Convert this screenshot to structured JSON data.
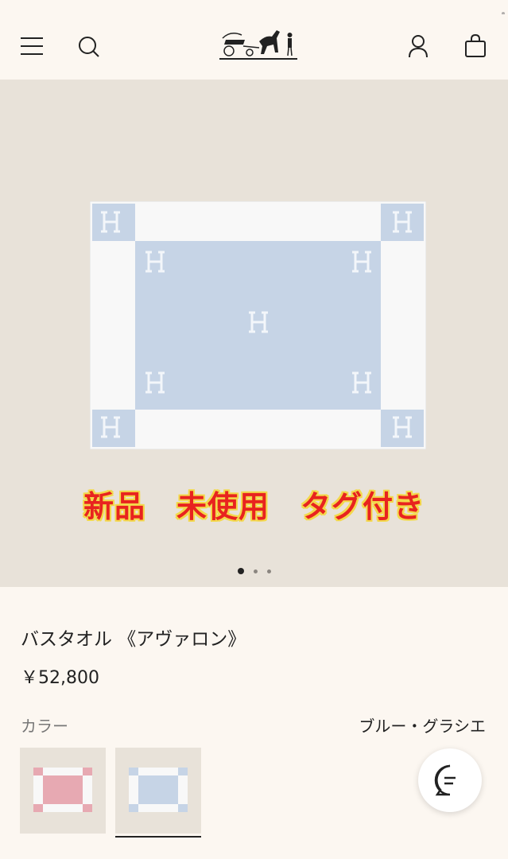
{
  "header": {
    "menu_icon": "hamburger-icon",
    "search_icon": "search-icon",
    "logo": "carriage-logo",
    "account_icon": "user-icon",
    "bag_icon": "shopping-bag-icon"
  },
  "hero": {
    "overlay_text": "新品　未使用　タグ付き",
    "carousel_total": 3,
    "carousel_active": 1
  },
  "product": {
    "title": "バスタオル 《アヴァロン》",
    "price": "￥52,800",
    "color_label": "カラー",
    "color_value": "ブルー・グラシエ",
    "swatches": [
      {
        "color": "pink",
        "accent": "#e7a9b2",
        "selected": false
      },
      {
        "color": "blue",
        "accent": "#c6d4e6",
        "selected": true
      }
    ]
  },
  "chat": {
    "icon": "chat-bubble-icon"
  },
  "colors": {
    "background": "#fcf7f1",
    "hero_bg": "#e8e2d9",
    "towel_blue": "#c6d4e6",
    "towel_white": "#f8f8f8",
    "badge_red": "#e8231f",
    "badge_outline": "#f3d84b"
  }
}
